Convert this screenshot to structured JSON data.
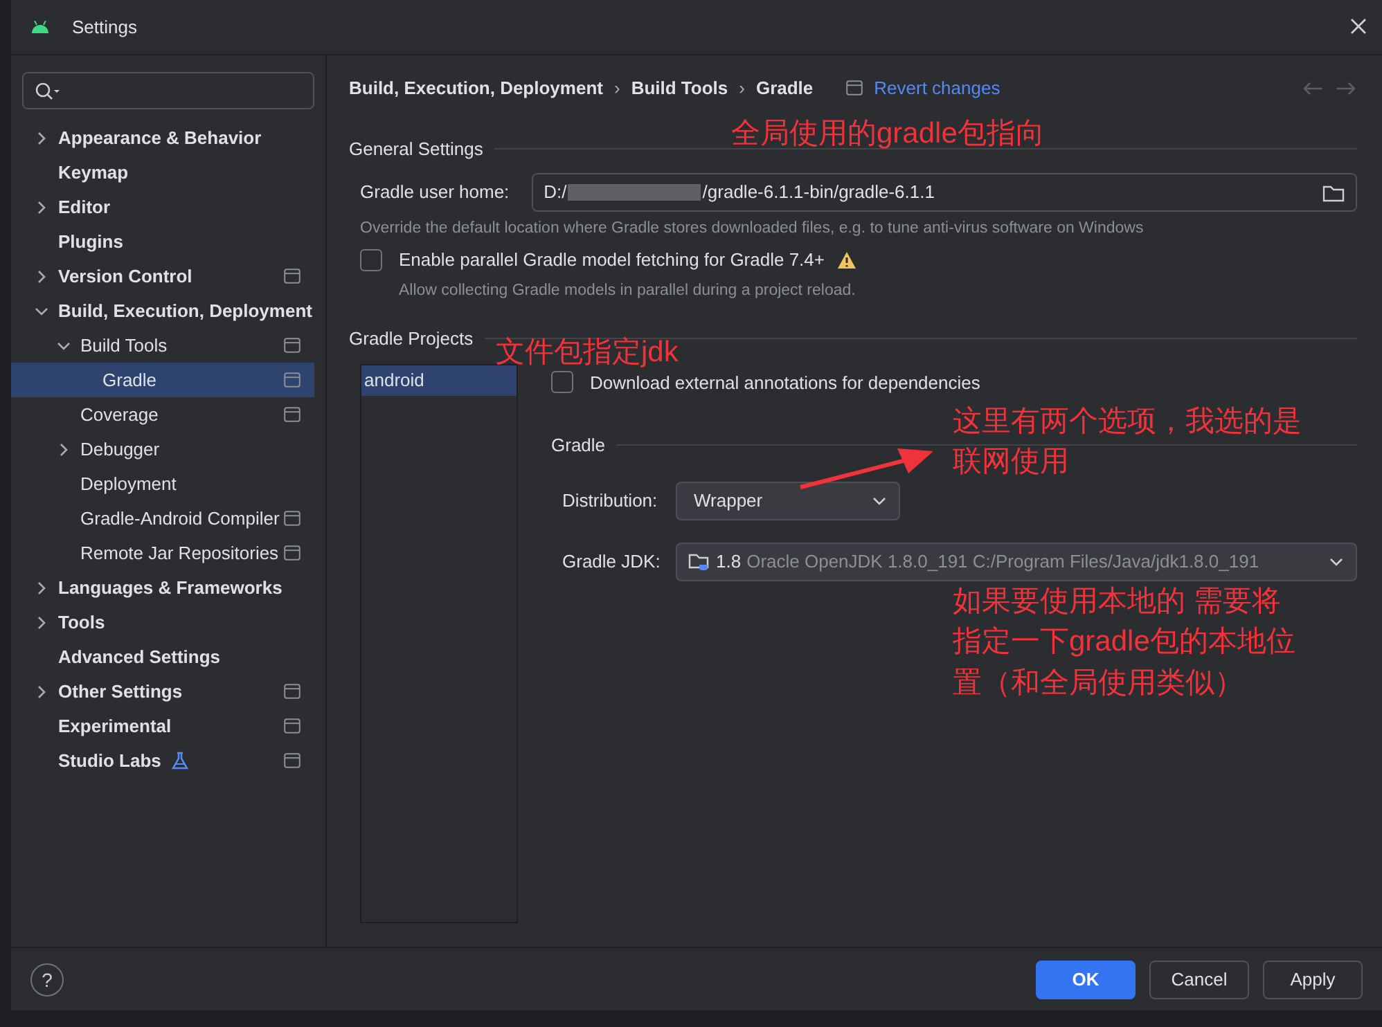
{
  "window": {
    "title": "Settings"
  },
  "sidebar": {
    "items": [
      {
        "label": "Appearance & Behavior",
        "expandable": true,
        "expanded": false,
        "project_level": false,
        "selected": false
      },
      {
        "label": "Keymap",
        "expandable": false,
        "project_level": false,
        "selected": false
      },
      {
        "label": "Editor",
        "expandable": true,
        "expanded": false,
        "project_level": false,
        "selected": false
      },
      {
        "label": "Plugins",
        "expandable": false,
        "project_level": false,
        "selected": false
      },
      {
        "label": "Version Control",
        "expandable": true,
        "expanded": false,
        "project_level": true,
        "selected": false
      },
      {
        "label": "Build, Execution, Deployment",
        "expandable": true,
        "expanded": true,
        "project_level": false,
        "selected": false,
        "children": [
          {
            "label": "Build Tools",
            "expandable": true,
            "expanded": true,
            "project_level": true,
            "selected": false,
            "children": [
              {
                "label": "Gradle",
                "expandable": false,
                "project_level": true,
                "selected": true
              }
            ]
          },
          {
            "label": "Coverage",
            "expandable": false,
            "project_level": true,
            "selected": false
          },
          {
            "label": "Debugger",
            "expandable": true,
            "expanded": false,
            "project_level": false,
            "selected": false
          },
          {
            "label": "Deployment",
            "expandable": false,
            "project_level": false,
            "selected": false
          },
          {
            "label": "Gradle-Android Compiler",
            "expandable": false,
            "project_level": true,
            "selected": false
          },
          {
            "label": "Remote Jar Repositories",
            "expandable": false,
            "project_level": true,
            "selected": false
          }
        ]
      },
      {
        "label": "Languages & Frameworks",
        "expandable": true,
        "expanded": false,
        "project_level": false,
        "selected": false
      },
      {
        "label": "Tools",
        "expandable": true,
        "expanded": false,
        "project_level": false,
        "selected": false
      },
      {
        "label": "Advanced Settings",
        "expandable": false,
        "project_level": false,
        "selected": false
      },
      {
        "label": "Other Settings",
        "expandable": true,
        "expanded": false,
        "project_level": true,
        "selected": false
      },
      {
        "label": "Experimental",
        "expandable": false,
        "project_level": true,
        "selected": false
      },
      {
        "label": "Studio Labs",
        "expandable": false,
        "project_level": true,
        "selected": false,
        "kind": "labs"
      }
    ]
  },
  "breadcrumb": [
    {
      "label": "Build, Execution, Deployment"
    },
    {
      "separator": "›",
      "label": "Build Tools"
    },
    {
      "separator": "›",
      "label": "Gradle"
    }
  ],
  "revert_link": "Revert changes",
  "general_settings": {
    "title": "General Settings",
    "user_home_label": "Gradle user home:",
    "user_home_prefix": "D:/",
    "user_home_suffix": "/gradle-6.1.1-bin/gradle-6.1.1",
    "user_home_hint": "Override the default location where Gradle stores downloaded files, e.g. to tune anti-virus software on Windows",
    "parallel_label": "Enable parallel Gradle model fetching for Gradle 7.4+",
    "parallel_checked": false,
    "parallel_hint": "Allow collecting Gradle models in parallel during a project reload."
  },
  "gradle_projects": {
    "title": "Gradle Projects",
    "projects": [
      {
        "label": "android",
        "selected": true
      }
    ],
    "annotations_label": "Download external annotations for dependencies",
    "annotations_checked": false,
    "gradle_title": "Gradle",
    "distribution_label": "Distribution:",
    "distribution_value": "Wrapper",
    "jdk_label": "Gradle JDK:",
    "jdk_version": "1.8",
    "jdk_detail": "Oracle OpenJDK 1.8.0_191 C:/Program Files/Java/jdk1.8.0_191"
  },
  "notes": [
    "全局使用的gradle包指向",
    "文件包指定jdk",
    "这里有两个选项，我选的是联网使用",
    "如果要使用本地的 需要将指定一下gradle包的本地位置（和全局使用类似）"
  ],
  "footer": {
    "help": "?",
    "buttons": [
      {
        "label": "OK",
        "kind": "primary"
      },
      {
        "label": "Cancel",
        "kind": "plain"
      },
      {
        "label": "Apply",
        "kind": "plain"
      }
    ]
  }
}
